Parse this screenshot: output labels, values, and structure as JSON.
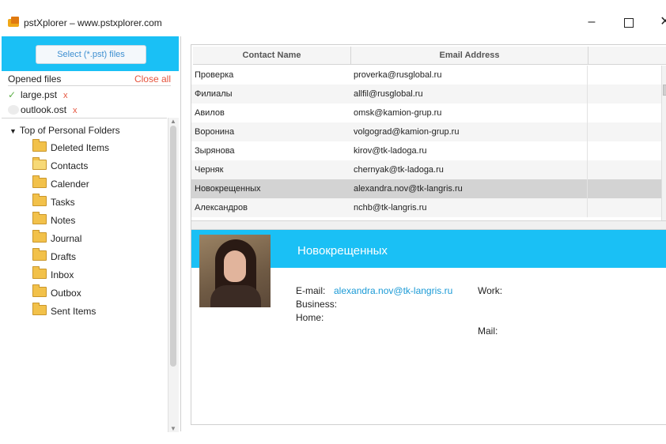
{
  "window": {
    "title": "pstXplorer – www.pstxplorer.com",
    "minimize_glyph": "–",
    "close_glyph": "✕"
  },
  "left": {
    "select_button": "Select (*.pst) files",
    "opened_files_label": "Opened files",
    "close_all_label": "Close all",
    "files": [
      {
        "name": "large.pst",
        "remove": "x",
        "status": "checked"
      },
      {
        "name": "outlook.ost",
        "remove": "x",
        "status": "unchecked"
      }
    ],
    "tree": {
      "root": "Top of Personal Folders",
      "folders": [
        "Deleted Items",
        "Contacts",
        "Calender",
        "Tasks",
        "Notes",
        "Journal",
        "Drafts",
        "Inbox",
        "Outbox",
        "Sent Items"
      ]
    }
  },
  "grid": {
    "columns": [
      "Contact Name",
      "Email Address"
    ],
    "rows": [
      {
        "name": "Проверка",
        "email": "proverka@rusglobal.ru"
      },
      {
        "name": "Филиалы",
        "email": "allfil@rusglobal.ru"
      },
      {
        "name": "Авилов",
        "email": "omsk@kamion-grup.ru"
      },
      {
        "name": "Воронина",
        "email": "volgograd@kamion-grup.ru"
      },
      {
        "name": "Зырянова",
        "email": "kirov@tk-ladoga.ru"
      },
      {
        "name": "Черняк",
        "email": "chernyak@tk-ladoga.ru"
      },
      {
        "name": "Новокрещенных",
        "email": "alexandra.nov@tk-langris.ru"
      },
      {
        "name": "Александров",
        "email": "nchb@tk-langris.ru"
      }
    ],
    "selected_index": 6
  },
  "detail": {
    "name": "Новокрещенных",
    "email_label": "E-mail:",
    "email_value": "alexandra.nov@tk-langris.ru",
    "business_label": "Business:",
    "home_label": "Home:",
    "work_label": "Work:",
    "mail_label": "Mail:"
  },
  "colors": {
    "accent": "#1ac0f5",
    "link": "#1a9ad6",
    "close_red": "#e5533c",
    "selected_row": "#d3d3d3"
  }
}
